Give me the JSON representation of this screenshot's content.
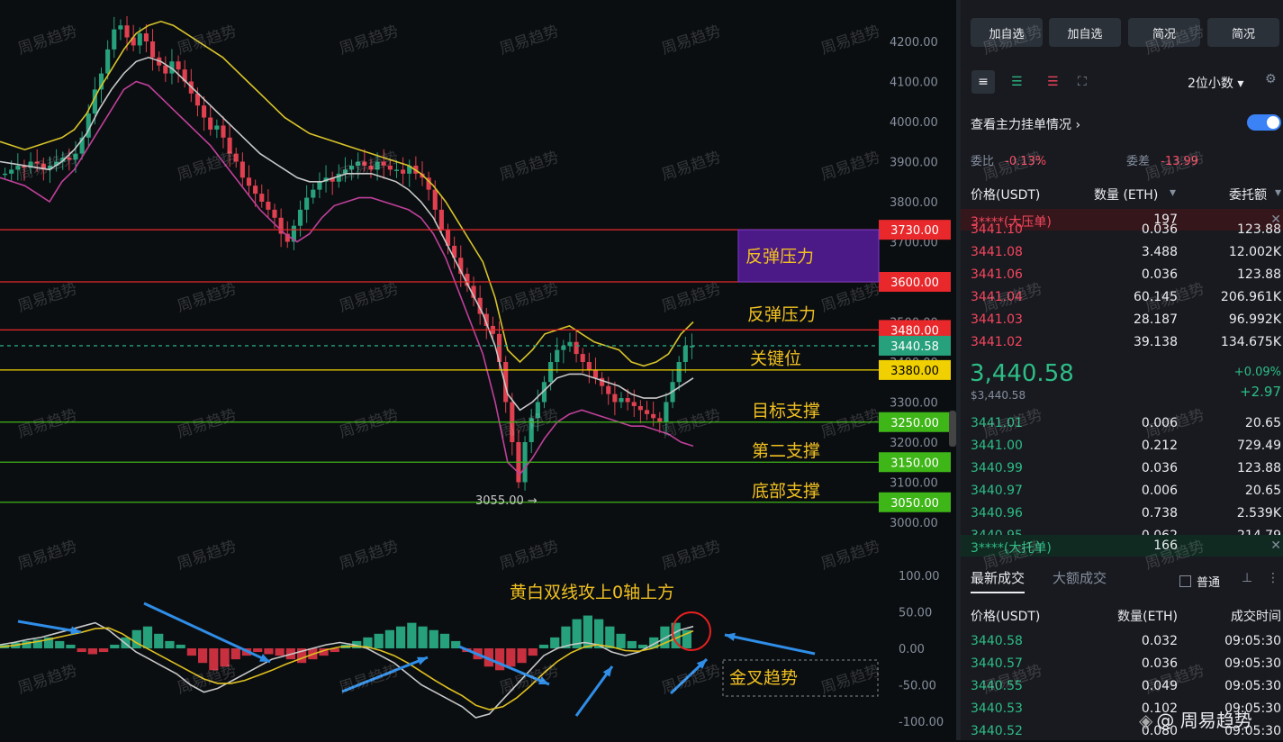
{
  "chart_data": {
    "type": "candlestick",
    "ylim": [
      3000,
      4250
    ],
    "yticks": [
      "4200.00",
      "4100.00",
      "4000.00",
      "3900.00",
      "3800.00",
      "3700.00",
      "3600.00",
      "3500.00",
      "3400.00",
      "3300.00",
      "3200.00",
      "3100.00",
      "3000.00"
    ],
    "levels": [
      {
        "value": 3730,
        "label": "3730.00",
        "color": "#e8282b"
      },
      {
        "value": 3600,
        "label": "3600.00",
        "color": "#e8282b"
      },
      {
        "value": 3480,
        "label": "3480.00",
        "color": "#e8282b"
      },
      {
        "value": 3440.58,
        "label": "3440.58",
        "color": "#26a17b"
      },
      {
        "value": 3380,
        "label": "3380.00",
        "color": "#f0d000"
      },
      {
        "value": 3250,
        "label": "3250.00",
        "color": "#3fb618"
      },
      {
        "value": 3150,
        "label": "3150.00",
        "color": "#3fb618"
      },
      {
        "value": 3050,
        "label": "3050.00",
        "color": "#3fb618"
      }
    ],
    "annotations": {
      "resistance_box": "反弹压力",
      "resistance_2": "反弹压力",
      "key_level": "关键位",
      "target_support": "目标支撑",
      "second_support": "第二支撑",
      "bottom_support": "底部支撑",
      "low_marker": "3055.00 →",
      "macd_note": "黄白双线攻上0轴上方",
      "golden_cross": "金叉趋势"
    },
    "candles_close": [
      3870,
      3880,
      3890,
      3885,
      3900,
      3895,
      3880,
      3890,
      3900,
      3910,
      3905,
      3920,
      3960,
      4020,
      4080,
      4120,
      4180,
      4230,
      4240,
      4210,
      4190,
      4220,
      4200,
      4160,
      4140,
      4120,
      4150,
      4130,
      4100,
      4070,
      4040,
      4010,
      3980,
      3990,
      3960,
      3920,
      3900,
      3860,
      3840,
      3820,
      3800,
      3780,
      3760,
      3720,
      3700,
      3740,
      3780,
      3810,
      3830,
      3850,
      3860,
      3850,
      3870,
      3880,
      3890,
      3900,
      3890,
      3880,
      3900,
      3890,
      3880,
      3880,
      3870,
      3890,
      3870,
      3860,
      3830,
      3780,
      3730,
      3690,
      3660,
      3620,
      3590,
      3560,
      3520,
      3490,
      3470,
      3400,
      3300,
      3200,
      3100,
      3200,
      3260,
      3300,
      3350,
      3400,
      3430,
      3440,
      3450,
      3420,
      3400,
      3380,
      3360,
      3340,
      3320,
      3300,
      3310,
      3300,
      3290,
      3280,
      3270,
      3260,
      3250,
      3300,
      3350,
      3400,
      3440,
      3440
    ],
    "bb_upper": [
      3950,
      3940,
      3930,
      3940,
      3950,
      3960,
      3980,
      4020,
      4080,
      4130,
      4180,
      4220,
      4240,
      4250,
      4240,
      4220,
      4200,
      4180,
      4160,
      4130,
      4100,
      4070,
      4040,
      4010,
      3990,
      3970,
      3960,
      3950,
      3940,
      3930,
      3920,
      3910,
      3900,
      3890,
      3870,
      3840,
      3800,
      3750,
      3700,
      3650,
      3560,
      3430,
      3400,
      3430,
      3470,
      3480,
      3490,
      3470,
      3450,
      3440,
      3430,
      3400,
      3390,
      3400,
      3420,
      3470,
      3500
    ],
    "bb_lower": [
      3860,
      3850,
      3840,
      3820,
      3800,
      3850,
      3880,
      3930,
      3980,
      4030,
      4080,
      4100,
      4090,
      4060,
      4030,
      4000,
      3970,
      3940,
      3900,
      3860,
      3820,
      3780,
      3750,
      3720,
      3700,
      3720,
      3760,
      3790,
      3800,
      3810,
      3810,
      3800,
      3790,
      3780,
      3760,
      3720,
      3660,
      3580,
      3500,
      3420,
      3300,
      3150,
      3120,
      3160,
      3210,
      3250,
      3270,
      3280,
      3270,
      3260,
      3250,
      3240,
      3240,
      3230,
      3220,
      3200,
      3190
    ],
    "bb_mid": [
      3900,
      3895,
      3890,
      3885,
      3880,
      3900,
      3930,
      3970,
      4030,
      4080,
      4120,
      4150,
      4160,
      4150,
      4130,
      4100,
      4070,
      4040,
      4010,
      3980,
      3950,
      3920,
      3900,
      3880,
      3860,
      3850,
      3850,
      3860,
      3870,
      3870,
      3870,
      3860,
      3850,
      3830,
      3800,
      3760,
      3700,
      3640,
      3580,
      3520,
      3440,
      3320,
      3280,
      3300,
      3330,
      3360,
      3370,
      3370,
      3360,
      3350,
      3340,
      3320,
      3310,
      3310,
      3320,
      3340,
      3360
    ],
    "macd_yticks": [
      "100.00",
      "50.00",
      "0.00",
      "-50.00",
      "-100.00"
    ],
    "macd_ylim": [
      -100,
      100
    ],
    "macd_hist": [
      5,
      8,
      10,
      12,
      15,
      10,
      5,
      -5,
      -8,
      -5,
      5,
      15,
      25,
      30,
      20,
      10,
      5,
      -10,
      -20,
      -30,
      -25,
      -15,
      -10,
      -5,
      -8,
      -10,
      -15,
      -20,
      -15,
      -10,
      -5,
      5,
      10,
      15,
      20,
      25,
      30,
      35,
      30,
      25,
      20,
      10,
      -5,
      -15,
      -25,
      -30,
      -25,
      -20,
      -10,
      5,
      15,
      30,
      40,
      45,
      40,
      30,
      20,
      10,
      5,
      15,
      30,
      35,
      25
    ],
    "macd_dif": [
      5,
      8,
      12,
      15,
      20,
      25,
      30,
      35,
      25,
      10,
      -5,
      -15,
      -25,
      -35,
      -50,
      -60,
      -55,
      -45,
      -35,
      -25,
      -15,
      -10,
      -5,
      0,
      5,
      8,
      5,
      0,
      -10,
      -20,
      -35,
      -50,
      -60,
      -70,
      -80,
      -95,
      -90,
      -70,
      -50,
      -30,
      -10,
      0,
      5,
      8,
      5,
      -5,
      -10,
      -5,
      5,
      15,
      25,
      30
    ],
    "macd_dea": [
      2,
      4,
      7,
      10,
      14,
      18,
      22,
      27,
      28,
      20,
      8,
      -2,
      -12,
      -22,
      -32,
      -42,
      -48,
      -48,
      -44,
      -37,
      -30,
      -22,
      -15,
      -8,
      -2,
      2,
      3,
      2,
      -3,
      -10,
      -20,
      -32,
      -44,
      -55,
      -65,
      -78,
      -84,
      -80,
      -68,
      -52,
      -34,
      -18,
      -6,
      2,
      5,
      2,
      -3,
      -4,
      0,
      8,
      16,
      24
    ]
  },
  "right_panel": {
    "top_buttons": [
      "加自选",
      "加自选",
      "简况",
      "简况"
    ],
    "tool_labels": {
      "decimals": "2位小数"
    },
    "main_order_label": "查看主力挂单情况",
    "commission_label": "委比",
    "commission_value": "-0.13%",
    "diff_label": "委差",
    "diff_value": "-13.99",
    "headers": [
      "价格(USDT)",
      "数量 (ETH)",
      "委托额"
    ],
    "big_ask": {
      "price": "3****(大压单)",
      "qty": "197"
    },
    "asks": [
      {
        "price": "3441.10",
        "qty": "0.036",
        "amount": "123.88"
      },
      {
        "price": "3441.08",
        "qty": "3.488",
        "amount": "12.002K"
      },
      {
        "price": "3441.06",
        "qty": "0.036",
        "amount": "123.88"
      },
      {
        "price": "3441.04",
        "qty": "60.145",
        "amount": "206.961K"
      },
      {
        "price": "3441.03",
        "qty": "28.187",
        "amount": "96.992K"
      },
      {
        "price": "3441.02",
        "qty": "39.138",
        "amount": "134.675K"
      }
    ],
    "last_price": "3,440.58",
    "last_price_usd": "$3,440.58",
    "change_pct": "+0.09%",
    "change_abs": "+2.97",
    "bids": [
      {
        "price": "3441.01",
        "qty": "0.006",
        "amount": "20.65"
      },
      {
        "price": "3441.00",
        "qty": "0.212",
        "amount": "729.49"
      },
      {
        "price": "3440.99",
        "qty": "0.036",
        "amount": "123.88"
      },
      {
        "price": "3440.97",
        "qty": "0.006",
        "amount": "20.65"
      },
      {
        "price": "3440.96",
        "qty": "0.738",
        "amount": "2.539K"
      },
      {
        "price": "3440.95",
        "qty": "0.062",
        "amount": "214.79"
      }
    ],
    "big_bid": {
      "price": "3****(大托单)",
      "qty": "166"
    },
    "trade_tabs": [
      "最新成交",
      "大额成交"
    ],
    "normal_label": "普通",
    "trade_headers": [
      "价格(USDT)",
      "数量(ETH)",
      "成交时间"
    ],
    "trades": [
      {
        "price": "3440.58",
        "qty": "0.032",
        "time": "09:05:30"
      },
      {
        "price": "3440.57",
        "qty": "0.036",
        "time": "09:05:30"
      },
      {
        "price": "3440.55",
        "qty": "0.049",
        "time": "09:05:30"
      },
      {
        "price": "3440.53",
        "qty": "0.102",
        "time": "09:05:30"
      },
      {
        "price": "3440.52",
        "qty": "0.080",
        "time": "09:05:30"
      }
    ],
    "logo_text": "@ 周易趋势"
  },
  "watermark": "周易趋势"
}
